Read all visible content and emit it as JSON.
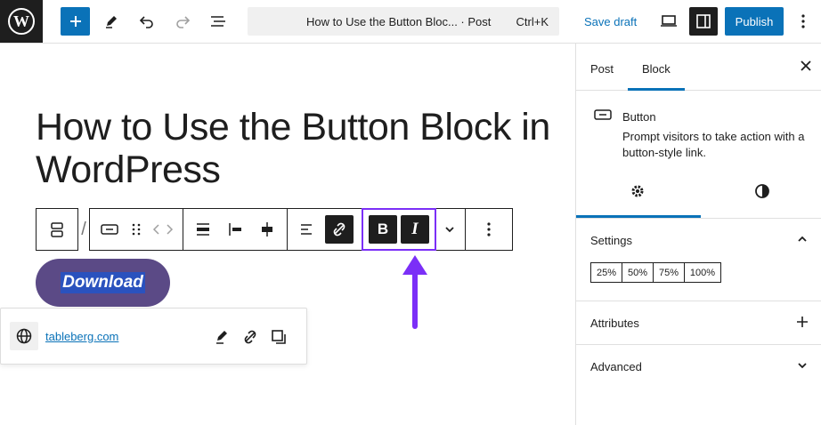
{
  "topbar": {
    "document_title": "How to Use the Button Bloc... · Post",
    "shortcut": "Ctrl+K",
    "save_draft_label": "Save draft",
    "publish_label": "Publish",
    "icons": [
      "wordpress-logo-icon",
      "plus-icon",
      "pen-icon",
      "undo-icon",
      "redo-icon",
      "list-view-icon",
      "desktop-preview-icon",
      "sidebar-icon",
      "more-vertical-icon"
    ]
  },
  "editor": {
    "post_title": "How to Use the Button Block in WordPress",
    "button_text": "Download",
    "button_color": "#5b4a86",
    "link_url": "tableberg.com",
    "toolbar_icons": [
      "buttons-parent-icon",
      "button-block-icon",
      "drag-handle-icon",
      "move-arrows-icon",
      "justify-icon",
      "align-left-icon",
      "align-center-icon",
      "text-align-icon",
      "unlink-icon",
      "bold-icon",
      "italic-icon",
      "chevron-down-icon",
      "more-options-icon"
    ],
    "bold_label": "B",
    "italic_label": "I",
    "highlight_color": "#7b2ff7"
  },
  "sidebar": {
    "tabs": [
      {
        "label": "Post"
      },
      {
        "label": "Block"
      }
    ],
    "active_tab": "Block",
    "block": {
      "name": "Button",
      "description": "Prompt visitors to take action with a button-style link."
    },
    "settings_title": "Settings",
    "width_options": [
      "25%",
      "50%",
      "75%",
      "100%"
    ],
    "attributes_title": "Attributes",
    "advanced_title": "Advanced"
  }
}
